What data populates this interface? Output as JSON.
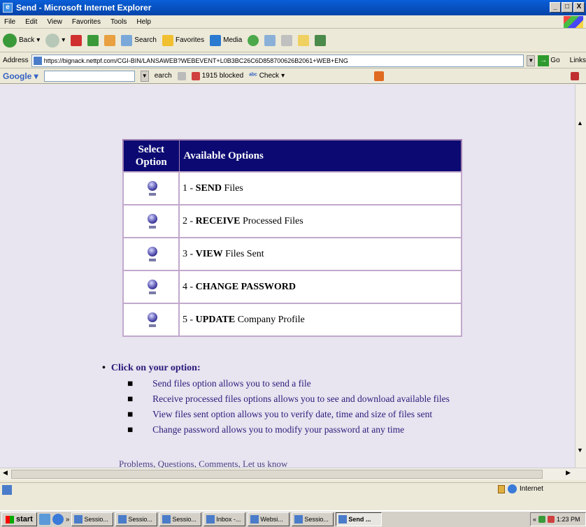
{
  "window": {
    "title": "Send - Microsoft Internet Explorer",
    "controls": [
      "_",
      "□",
      "X"
    ]
  },
  "menu": [
    "File",
    "Edit",
    "View",
    "Favorites",
    "Tools",
    "Help"
  ],
  "toolbar": {
    "back": "Back",
    "search": "Search",
    "favorites": "Favorites",
    "media": "Media"
  },
  "address": {
    "label": "Address",
    "url": "https://bignack.nettpf.com/CGI-BIN/LANSAWEB?WEBEVENT+L0B3BC26C6D858700626B2061+WEB+ENG",
    "go": "Go",
    "links": "Links"
  },
  "googlebar": {
    "logo": "Google",
    "search": "earch",
    "blocked": "1915 blocked",
    "check": "Check"
  },
  "options_table": {
    "col_select": "Select Option",
    "col_available": "Available Options",
    "rows": [
      {
        "prefix": "1 - ",
        "bold": "SEND",
        "rest": " Files"
      },
      {
        "prefix": "2 - ",
        "bold": "RECEIVE",
        "rest": " Processed Files"
      },
      {
        "prefix": "3 - ",
        "bold": "VIEW",
        "rest": " Files Sent"
      },
      {
        "prefix": "4 - ",
        "bold": "CHANGE PASSWORD",
        "rest": ""
      },
      {
        "prefix": "5 - ",
        "bold": "UPDATE",
        "rest": " Company Profile"
      }
    ]
  },
  "instructions": {
    "heading": "Click on your option:",
    "items": [
      "Send files option allows you to send a file",
      "Receive processed files options allows you to see and download available files",
      "View files sent option allows you to verify date, time and size of files sent",
      "Change password allows you to modify your password at any time"
    ],
    "footer": "Problems, Questions, Comments, Let us know"
  },
  "status": {
    "zone": "Internet"
  },
  "taskbar": {
    "start": "start",
    "tasks": [
      "Sessio...",
      "Sessio...",
      "Sessio...",
      "Inbox -...",
      "Websi...",
      "Sessio...",
      "Send ..."
    ],
    "time": "1:23 PM"
  }
}
